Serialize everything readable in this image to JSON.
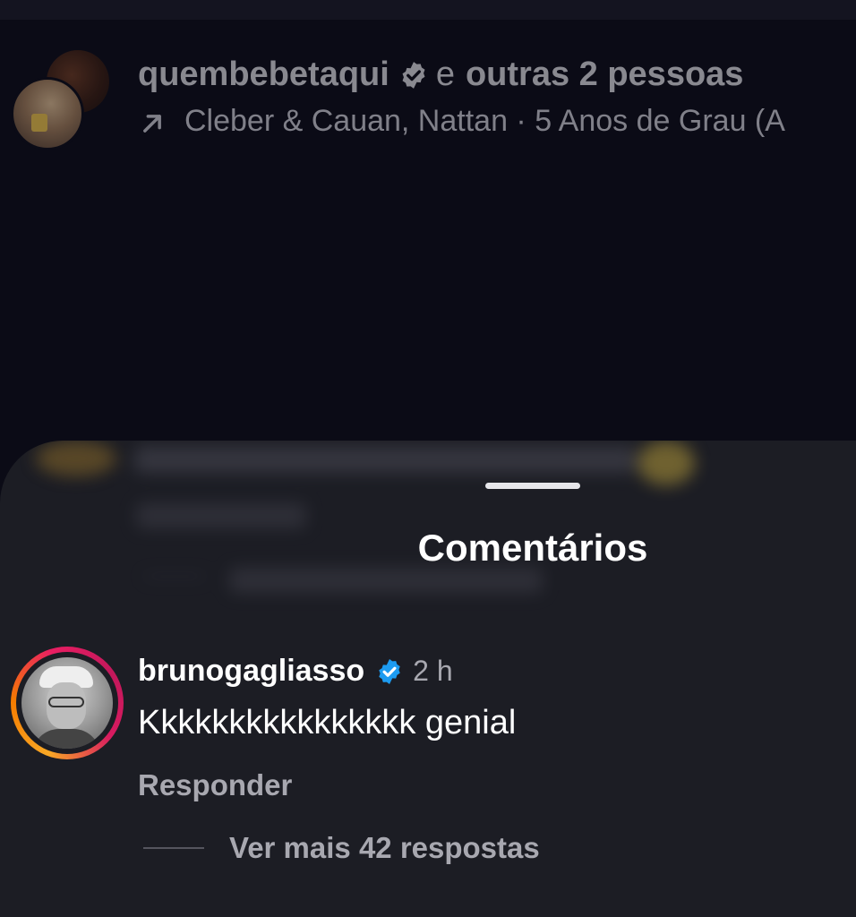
{
  "post": {
    "username": "quembebetaqui",
    "others_prefix": "e",
    "others_text": "outras 2 pessoas",
    "music_text": "Cleber & Cauan, Nattan · 5 Anos de Grau (A",
    "icons": {
      "verified": "verified-badge-icon",
      "music_arrow": "arrow-up-right-icon"
    }
  },
  "comments_sheet": {
    "title": "Comentários",
    "comment": {
      "username": "brunogagliasso",
      "time": "2 h",
      "text": "Kkkkkkkkkkkkkkkk genial",
      "reply_label": "Responder",
      "view_replies_label": "Ver mais 42 respostas"
    }
  },
  "colors": {
    "sheet_background": "#1c1d24",
    "verified_blue": "#1d9bf0",
    "muted_text": "#a8a8b0"
  }
}
